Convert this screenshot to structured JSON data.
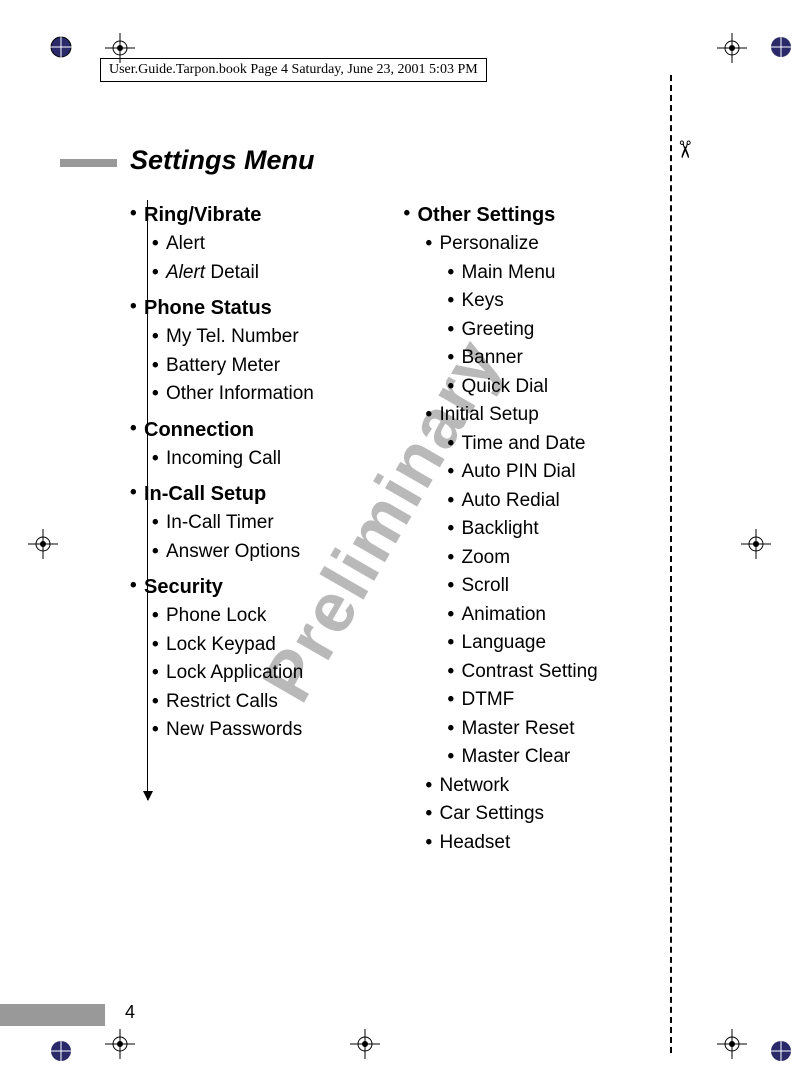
{
  "header": "User.Guide.Tarpon.book  Page 4  Saturday, June 23, 2001  5:03 PM",
  "title": "Settings Menu",
  "watermark": "Preliminary",
  "page_number": "4",
  "scissors": "✂",
  "left_column": [
    {
      "label": "Ring/Vibrate",
      "children": [
        {
          "label": "Alert"
        },
        {
          "label_italic": "Alert",
          "label_rest": " Detail"
        }
      ]
    },
    {
      "label": "Phone Status",
      "children": [
        {
          "label": "My Tel. Number"
        },
        {
          "label": "Battery Meter"
        },
        {
          "label": "Other Information"
        }
      ]
    },
    {
      "label": "Connection",
      "children": [
        {
          "label": "Incoming Call"
        }
      ]
    },
    {
      "label": "In-Call Setup",
      "children": [
        {
          "label": "In-Call Timer"
        },
        {
          "label": "Answer Options"
        }
      ]
    },
    {
      "label": "Security",
      "children": [
        {
          "label": "Phone Lock"
        },
        {
          "label": "Lock Keypad"
        },
        {
          "label": "Lock Application"
        },
        {
          "label": "Restrict Calls"
        },
        {
          "label": "New Passwords"
        }
      ]
    }
  ],
  "right_column": [
    {
      "label": "Other Settings",
      "children": [
        {
          "label": "Personalize",
          "children": [
            {
              "label": "Main Menu"
            },
            {
              "label": "Keys"
            },
            {
              "label": "Greeting"
            },
            {
              "label": "Banner"
            },
            {
              "label": "Quick Dial"
            }
          ]
        },
        {
          "label": "Initial Setup",
          "children": [
            {
              "label": "Time and Date"
            },
            {
              "label": "Auto PIN Dial"
            },
            {
              "label": "Auto Redial"
            },
            {
              "label": "Backlight"
            },
            {
              "label": "Zoom"
            },
            {
              "label": "Scroll"
            },
            {
              "label": "Animation"
            },
            {
              "label": "Language"
            },
            {
              "label": "Contrast Setting"
            },
            {
              "label": "DTMF"
            },
            {
              "label": "Master Reset"
            },
            {
              "label": "Master Clear"
            }
          ]
        },
        {
          "label": "Network"
        },
        {
          "label": "Car Settings"
        },
        {
          "label": "Headset"
        }
      ]
    }
  ]
}
